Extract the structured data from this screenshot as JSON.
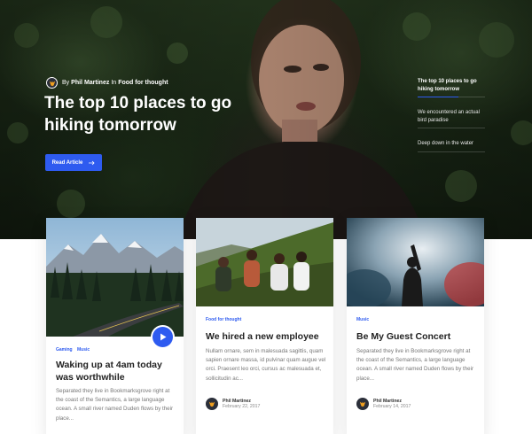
{
  "hero": {
    "byline_prefix": "By",
    "author": "Phil Martinez",
    "byline_in": "In",
    "category": "Food for thought",
    "title": "The top 10 places to go hiking tomorrow",
    "cta_label": "Read Article",
    "side_list": [
      {
        "label": "The top 10 places to go hiking tomorrow",
        "active": true
      },
      {
        "label": "We encountered an actual bird paradise",
        "active": false
      },
      {
        "label": "Deep down in the water",
        "active": false
      }
    ]
  },
  "cards": [
    {
      "categories": [
        "Gaming",
        "Music"
      ],
      "title": "Waking up at 4am today was worthwhile",
      "excerpt": "Separated they live in Bookmarksgrove right at the coast of the Semantics, a large language ocean. A small river named Duden flows by their place..."
    },
    {
      "categories": [
        "Food for thought"
      ],
      "title": "We hired a new employee",
      "excerpt": "Nullam ornare, sem in malesuada sagittis, quam sapien ornare massa, id pulvinar quam augue vel orci. Praesent leo orci, cursus ac malesuada et, sollicitudin ac...",
      "author": "Phil Martinez",
      "date": "February 22, 2017"
    },
    {
      "categories": [
        "Music"
      ],
      "title": "Be My Guest Concert",
      "excerpt": "Separated they live in Bookmarksgrove right at the coast of the Semantics, a large language ocean. A small river named Duden flows by their place...",
      "author": "Phil Martinez",
      "date": "February 14, 2017"
    }
  ],
  "colors": {
    "accent": "#2e5bf0",
    "title_text": "#222222",
    "body_text": "#777777"
  },
  "icons": {
    "avatar": "fox-logo-icon",
    "cta": "arrow-right-icon",
    "video": "play-icon"
  }
}
